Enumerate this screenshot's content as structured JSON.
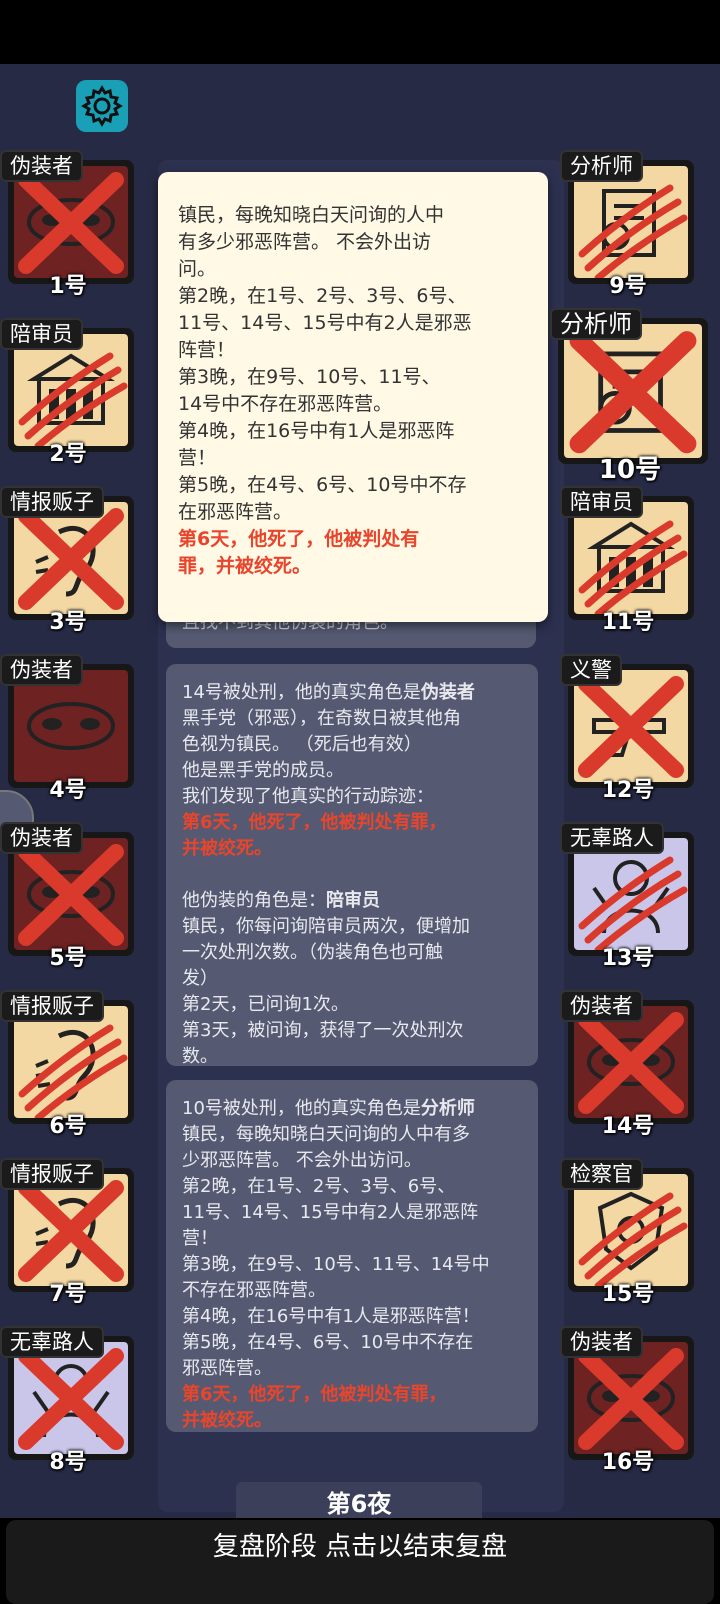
{
  "colors": {
    "evil_bg": "#6e2222",
    "town_bg": "#f4d8a4",
    "outsider_bg": "#c9c6ea",
    "accent": "#1aa0b6",
    "text_red": "#e8452c"
  },
  "settings_icon": "gear-icon",
  "players_left": [
    {
      "role": "伪装者",
      "num": "1号",
      "bg": "evil",
      "icon": "mask-icon",
      "mark": "cross"
    },
    {
      "role": "陪审员",
      "num": "2号",
      "bg": "town",
      "icon": "building-icon",
      "mark": "claw"
    },
    {
      "role": "情报贩子",
      "num": "3号",
      "bg": "town",
      "icon": "ear-icon",
      "mark": "cross"
    },
    {
      "role": "伪装者",
      "num": "4号",
      "bg": "evil",
      "icon": "mask-icon",
      "mark": "none"
    },
    {
      "role": "伪装者",
      "num": "5号",
      "bg": "evil",
      "icon": "mask-icon",
      "mark": "cross"
    },
    {
      "role": "情报贩子",
      "num": "6号",
      "bg": "town",
      "icon": "ear-icon",
      "mark": "claw"
    },
    {
      "role": "情报贩子",
      "num": "7号",
      "bg": "town",
      "icon": "ear-icon",
      "mark": "cross"
    },
    {
      "role": "无辜路人",
      "num": "8号",
      "bg": "outsider",
      "icon": "person-icon",
      "mark": "cross"
    }
  ],
  "players_right": [
    {
      "role": "分析师",
      "num": "9号",
      "bg": "town",
      "icon": "document-icon",
      "mark": "claw"
    },
    {
      "role": "分析师",
      "num": "10号",
      "bg": "town",
      "icon": "document-icon",
      "mark": "cross",
      "big": true
    },
    {
      "role": "陪审员",
      "num": "11号",
      "bg": "town",
      "icon": "building-icon",
      "mark": "claw"
    },
    {
      "role": "义警",
      "num": "12号",
      "bg": "town",
      "icon": "gun-icon",
      "mark": "cross"
    },
    {
      "role": "无辜路人",
      "num": "13号",
      "bg": "outsider",
      "icon": "person-icon",
      "mark": "claw"
    },
    {
      "role": "伪装者",
      "num": "14号",
      "bg": "evil",
      "icon": "mask-icon",
      "mark": "cross"
    },
    {
      "role": "检察官",
      "num": "15号",
      "bg": "town",
      "icon": "badge-icon",
      "mark": "claw"
    },
    {
      "role": "伪装者",
      "num": "16号",
      "bg": "evil",
      "icon": "mask-icon",
      "mark": "cross"
    }
  ],
  "popup": {
    "lines": [
      "镇民，每晚知晓白天问询的人中",
      "有多少邪恶阵营。 不会外出访",
      "问。",
      "第2晚，在1号、2号、3号、6号、",
      "11号、14号、15号中有2人是邪恶",
      "阵营！",
      "第3晚，在9号、10号、11号、",
      "14号中不存在邪恶阵营。",
      "第4晚，在16号中有1人是邪恶阵",
      "营！",
      "第5晚，在4号、6号、10号中不存",
      "在邪恶阵营。"
    ],
    "death_lines": [
      "第6天，他死了，他被判处有",
      "罪，并被绞死。"
    ]
  },
  "peek_card_text": "且找不到其他伪装的角色。",
  "card14": {
    "intro": "14号被处刑，他的真实角色是",
    "role": "伪装者",
    "lines": [
      "黑手党（邪恶），在奇数日被其他角",
      "色视为镇民。 （死后也有效）",
      "他是黑手党的成员。",
      "我们发现了他真实的行动踪迹："
    ],
    "death_lines": [
      "第6天，他死了，他被判处有罪，",
      "并被绞死。"
    ],
    "disguise_intro": "他伪装的角色是：",
    "disguise_role": "陪审员",
    "disguise_lines": [
      "镇民，你每问询陪审员两次，便增加",
      "一次处刑次数。（伪装角色也可触",
      "发）",
      "第2天，已问询1次。",
      "第3天，被问询，获得了一次处刑次",
      "数。"
    ]
  },
  "card10": {
    "intro": "10号被处刑，他的真实角色是",
    "role": "分析师",
    "lines": [
      "镇民，每晚知晓白天问询的人中有多",
      "少邪恶阵营。 不会外出访问。",
      "第2晚，在1号、2号、3号、6号、",
      "11号、14号、15号中有2人是邪恶阵",
      "营！",
      "第3晚，在9号、10号、11号、14号中",
      "不存在邪恶阵营。",
      "第4晚，在16号中有1人是邪恶阵营！",
      "第5晚，在4号、6号、10号中不存在",
      "邪恶阵营。"
    ],
    "death_lines": [
      "第6天，他死了，他被判处有罪，",
      "并被绞死。"
    ]
  },
  "night_label": "第6夜",
  "bottom_button": "复盘阶段 点击以结束复盘"
}
